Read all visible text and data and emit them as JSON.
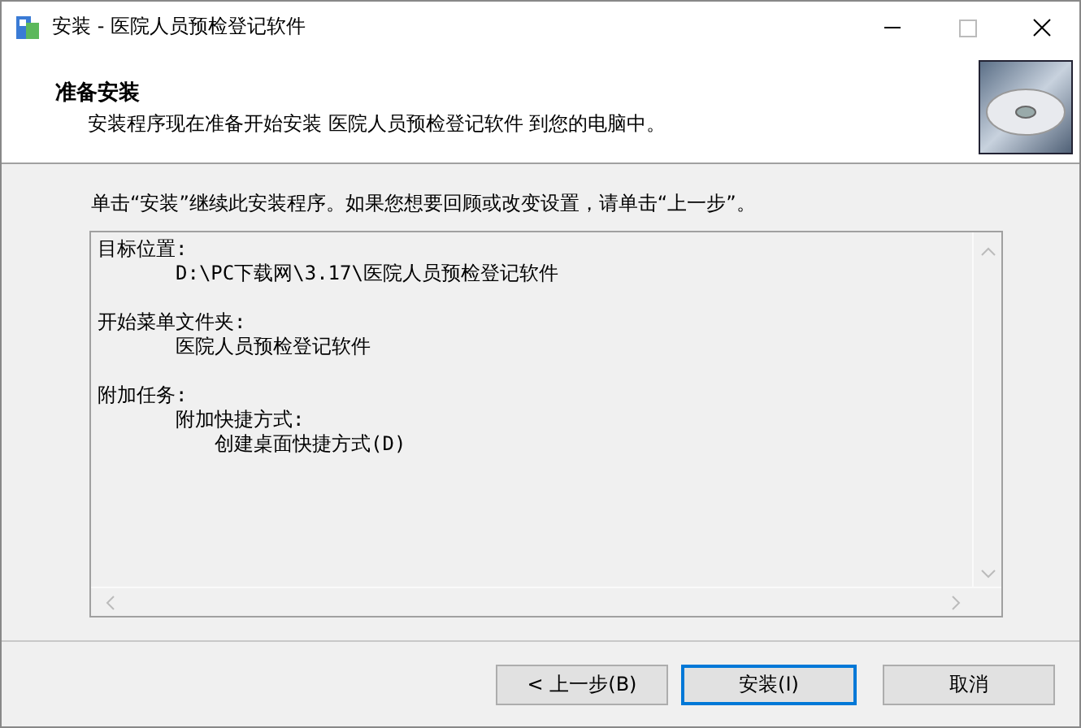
{
  "window": {
    "title": "安装 - 医院人员预检登记软件"
  },
  "header": {
    "title": "准备安装",
    "subtitle": "安装程序现在准备开始安装 医院人员预检登记软件 到您的电脑中。"
  },
  "instruction": "单击“安装”继续此安装程序。如果您想要回顾或改变设置，请单击“上一步”。",
  "memo": [
    {
      "text": "目标位置:",
      "children": [
        {
          "text": "D:\\PC下载网\\3.17\\医院人员预检登记软件"
        }
      ]
    },
    {
      "text": "开始菜单文件夹:",
      "children": [
        {
          "text": "医院人员预检登记软件"
        }
      ]
    },
    {
      "text": "附加任务:",
      "children": [
        {
          "text": "附加快捷方式:",
          "children": [
            {
              "text": "创建桌面快捷方式(D)"
            }
          ]
        }
      ]
    }
  ],
  "buttons": [
    {
      "label": "< 上一步(B)",
      "default": false
    },
    {
      "label": "安装(I)",
      "default": true
    },
    {
      "label": "取消",
      "default": false
    }
  ]
}
